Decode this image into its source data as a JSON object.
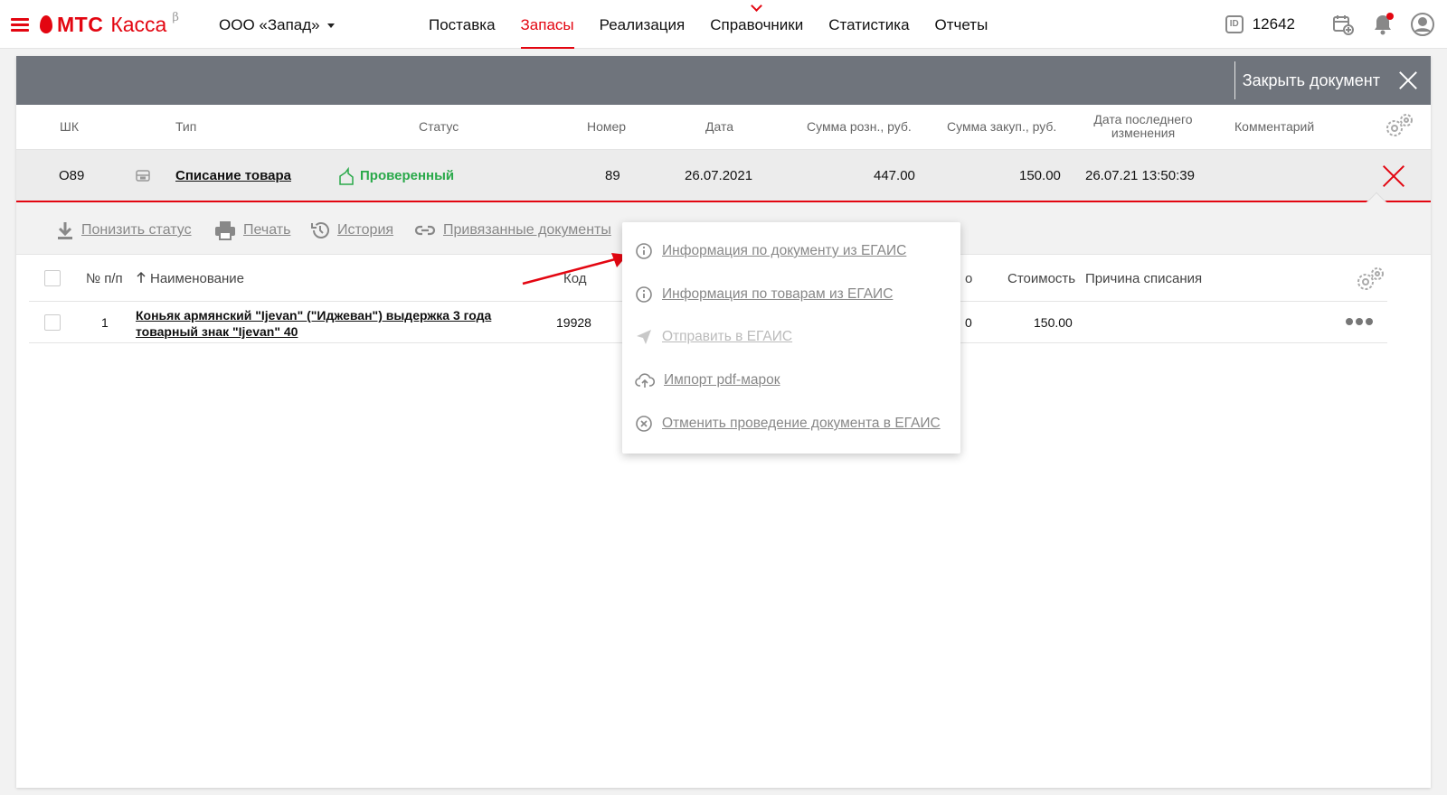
{
  "header": {
    "brand": "МТС",
    "product": "Касса",
    "beta": "β",
    "organization": "ООО «Запад»",
    "nav": [
      "Поставка",
      "Запасы",
      "Реализация",
      "Справочники",
      "Статистика",
      "Отчеты"
    ],
    "active_nav": "Запасы",
    "id_label": "ID",
    "id_number": "12642",
    "accent_color": "#e30611"
  },
  "doc_bar": {
    "close_label": "Закрыть документ"
  },
  "doc_table": {
    "headers": {
      "barcode": "ШК",
      "type": "Тип",
      "status": "Статус",
      "number": "Номер",
      "date": "Дата",
      "retail_sum": "Сумма розн., руб.",
      "purchase_sum": "Сумма закуп., руб.",
      "last_change_1": "Дата последнего",
      "last_change_2": "изменения",
      "comment": "Комментарий"
    },
    "row": {
      "barcode": "O89",
      "type": "Списание товара",
      "status": "Проверенный",
      "number": "89",
      "date": "26.07.2021",
      "retail_sum": "447.00",
      "purchase_sum": "150.00",
      "last_change": "26.07.21 13:50:39",
      "comment": ""
    }
  },
  "actions": {
    "lower_status": "Понизить статус",
    "print": "Печать",
    "history": "История",
    "linked_docs": "Привязанные документы"
  },
  "items_table": {
    "headers": {
      "index": "№ п/п",
      "name": "Наименование",
      "code": "Код",
      "partial": "о",
      "cost": "Стоимость",
      "reason": "Причина списания"
    },
    "rows": [
      {
        "index": "1",
        "name_line1": "Коньяк армянский \"Ijevan\" (\"Иджеван\") выдержка 3 года",
        "name_line2": "товарный знак \"Ijevan\" 40",
        "code": "19928",
        "partial": "0",
        "cost": "150.00",
        "reason": ""
      }
    ]
  },
  "menu": {
    "items": [
      {
        "label": "Информация по документу из ЕГАИС",
        "icon": "info-icon",
        "enabled": true
      },
      {
        "label": "Информация по товарам из ЕГАИС",
        "icon": "info-icon",
        "enabled": true
      },
      {
        "label": "Отправить в ЕГАИС",
        "icon": "send-icon",
        "enabled": false
      },
      {
        "label": "Импорт pdf-марок",
        "icon": "cloud-upload-icon",
        "enabled": true
      },
      {
        "label": "Отменить проведение документа в ЕГАИС",
        "icon": "cancel-circle-icon",
        "enabled": true
      }
    ]
  }
}
